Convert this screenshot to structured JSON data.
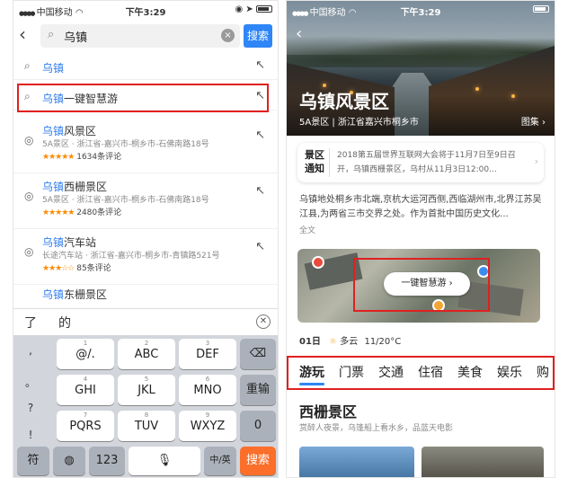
{
  "left": {
    "status": {
      "carrier": "中国移动",
      "time": "下午3:29"
    },
    "search": {
      "query": "乌镇",
      "clear": "×",
      "button": "搜索"
    },
    "suggestions": [
      {
        "highlight": "乌镇",
        "rest": ""
      },
      {
        "highlight": "乌镇",
        "rest": "一键智慧游"
      }
    ],
    "places": [
      {
        "highlight": "乌镇",
        "rest": "风景区",
        "address": "5A景区 · 浙江省-嘉兴市-桐乡市-石佛南路18号",
        "stars": "★★★★★",
        "reviews": "1634条评论"
      },
      {
        "highlight": "乌镇",
        "rest": "西栅景区",
        "address": "5A景区 · 浙江省-嘉兴市-桐乡市-石佛南路18号",
        "stars": "★★★★★",
        "reviews": "2480条评论"
      },
      {
        "highlight": "乌镇",
        "rest": "汽车站",
        "address": "长途汽车站 · 浙江省-嘉兴市-桐乡市-青镇路521号",
        "stars": "★★★☆☆",
        "reviews": "85条评论"
      }
    ],
    "partial_item": {
      "highlight": "乌镇",
      "rest": "东栅景区"
    },
    "candidates": [
      "了",
      "的"
    ],
    "keyboard": {
      "side": [
        ",",
        "。",
        "?",
        "!"
      ],
      "row1": [
        {
          "sub": "1",
          "label": "@/."
        },
        {
          "sub": "2",
          "label": "ABC"
        },
        {
          "sub": "3",
          "label": "DEF"
        }
      ],
      "row2": [
        {
          "sub": "4",
          "label": "GHI"
        },
        {
          "sub": "5",
          "label": "JKL"
        },
        {
          "sub": "6",
          "label": "MNO"
        }
      ],
      "row3": [
        {
          "sub": "7",
          "label": "PQRS"
        },
        {
          "sub": "8",
          "label": "TUV"
        },
        {
          "sub": "9",
          "label": "WXYZ"
        }
      ],
      "delete": "⌫",
      "reenter": "重输",
      "zero": "0",
      "symbol": "符",
      "numbers": "123",
      "lang": "中/英",
      "search": "搜索"
    }
  },
  "right": {
    "status": {
      "carrier": "中国移动",
      "time": "下午3:29"
    },
    "hero": {
      "title": "乌镇风景区",
      "subtitle": "5A景区 | 浙江省嘉兴市桐乡市",
      "gallery": "图集 ›"
    },
    "notice": {
      "tag_line1": "景区",
      "tag_line2": "通知",
      "text": "2018第五届世界互联网大会将于11月7日至9日召开，乌镇西栅景区，乌村从11月3日12:00..."
    },
    "intro": "乌镇地处桐乡市北端,京杭大运河西侧,西临湖州市,北界江苏吴江县,为两省三市交界之处。作为首批中国历史文化...",
    "fulltext": "全文",
    "map": {
      "button": "一键智慧游 ›"
    },
    "weather": {
      "date": "01日",
      "condition": "多云",
      "temp": "11/20°C"
    },
    "tabs": [
      "游玩",
      "门票",
      "交通",
      "住宿",
      "美食",
      "娱乐",
      "购"
    ],
    "section": {
      "title": "西栅景区",
      "subtitle": "赏醉人夜景，乌篷船上看水乡，品蓝天电影"
    }
  },
  "colors": {
    "accent": "#2f86f6",
    "highlight_box": "#e02020",
    "keyboard_orange": "#fb6f2b"
  }
}
